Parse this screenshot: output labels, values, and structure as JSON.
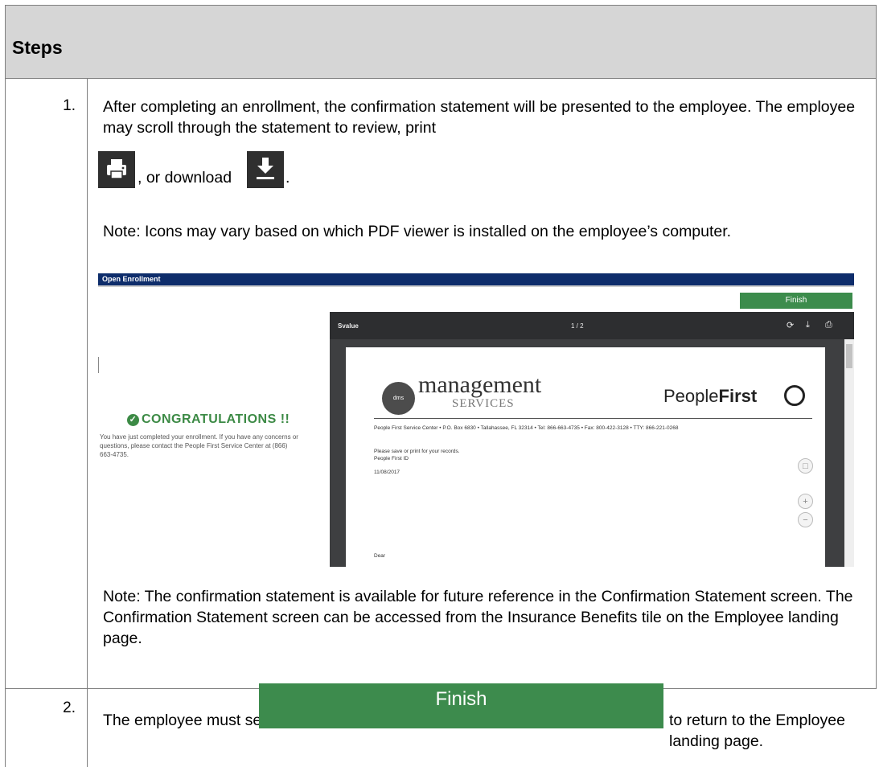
{
  "header": {
    "title": "Steps"
  },
  "steps": [
    {
      "number": "1.",
      "text_intro": "After completing an enrollment, the confirmation statement will be presented to the employee. The employee may scroll through the statement to review, print",
      "text_or_download": ", or download",
      "text_period": ".",
      "note_icons": "Note: Icons may vary based on which PDF viewer is installed on the employee’s computer.",
      "note_confirmation": "Note: The confirmation statement is available for future reference in the Confirmation Statement screen. The Confirmation Statement screen can be accessed from the Insurance Benefits tile on the Employee landing page."
    },
    {
      "number": "2.",
      "text_before": "The employee must select",
      "text_after": "to return to the Employee landing page."
    }
  ],
  "icons": {
    "print": "print-icon",
    "download": "download-icon"
  },
  "screenshot": {
    "bar_title": "Open Enrollment",
    "finish_label": "Finish",
    "congrats": "CONGRATULATIONS !!",
    "message": "You have just completed your enrollment. If you have any concerns or questions, please contact the People First Service Center at (866) 663-4735.",
    "viewer": {
      "file_name": "Svalue",
      "page_indicator": "1 / 2",
      "logo_management": "management",
      "logo_services": "SERVICES",
      "logo_people": "People",
      "logo_first": "First",
      "address": "People First Service Center • P.O. Box 6830 • Tallahassee, FL 32314 • Tel: 866-663-4735 • Fax: 800-422-3128 • TTY: 866-221-0268",
      "line1": "Please save or print for your records.",
      "line2": "People First ID",
      "date": "11/08/2017",
      "dear": "Dear"
    }
  },
  "finish_button": {
    "label": "Finish"
  },
  "colors": {
    "header_bg": "#d6d6d6",
    "finish_green": "#3d8b4d",
    "enrollment_bar": "#0e2d6b"
  }
}
